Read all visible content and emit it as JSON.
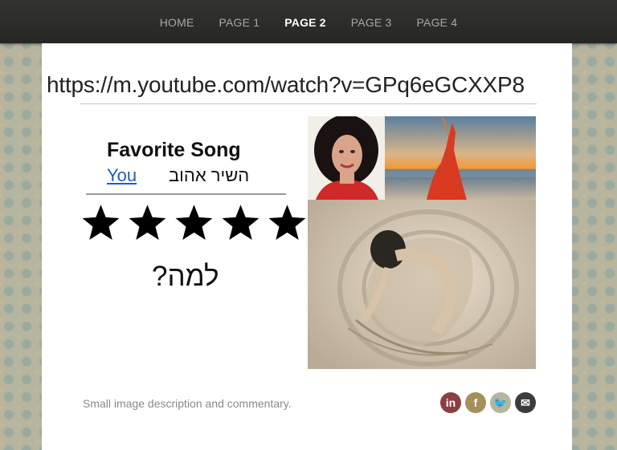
{
  "nav": {
    "items": [
      {
        "label": "HOME",
        "active": false
      },
      {
        "label": "PAGE 1",
        "active": false
      },
      {
        "label": "PAGE 2",
        "active": true
      },
      {
        "label": "PAGE 3",
        "active": false
      },
      {
        "label": "PAGE 4",
        "active": false
      }
    ]
  },
  "main": {
    "url": "https://m.youtube.com/watch?v=GPq6eGCXXP8",
    "song_title": "Favorite Song",
    "song_link": "You",
    "song_hebrew": "השיר אהוב",
    "rating": 5,
    "rating_max": 5,
    "question": "למה?"
  },
  "footer": {
    "caption": "Small image description and commentary.",
    "social": [
      {
        "icon": "linkedin-icon",
        "glyph": "in",
        "color": "#8c3f3f"
      },
      {
        "icon": "facebook-icon",
        "glyph": "f",
        "color": "#a58f5a"
      },
      {
        "icon": "twitter-icon",
        "glyph": "🐦",
        "color": "#b5b5a0"
      },
      {
        "icon": "email-icon",
        "glyph": "✉",
        "color": "#3c3c3c"
      }
    ]
  },
  "colors": {
    "nav_bg": "#2c2c2a",
    "nav_active": "#ffffff",
    "nav_inactive": "#a8a8a8",
    "link": "#1a5cc8"
  }
}
